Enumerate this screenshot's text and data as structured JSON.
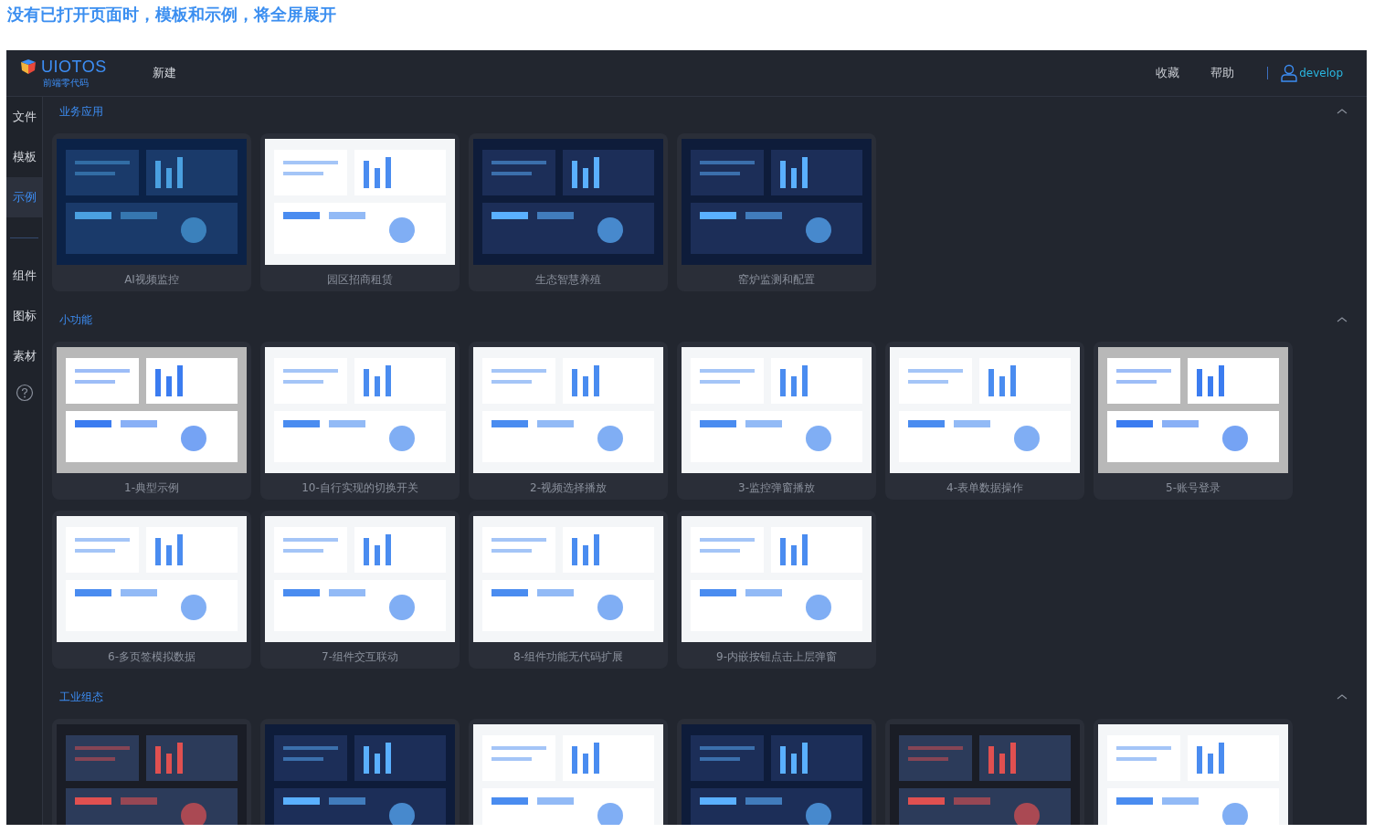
{
  "heading": "没有已打开页面时，模板和示例，将全屏展开",
  "logo": {
    "name": "UIOTOS",
    "tagline": "前端零代码"
  },
  "top_menu": [
    {
      "label": "新建"
    }
  ],
  "top_links": [
    {
      "label": "收藏"
    },
    {
      "label": "帮助"
    }
  ],
  "user": {
    "name": "develop"
  },
  "sidebar": {
    "items": [
      {
        "label": "文件",
        "selected": false
      },
      {
        "label": "模板",
        "selected": false
      },
      {
        "label": "示例",
        "selected": true
      },
      {
        "label": "组件",
        "selected": false
      },
      {
        "label": "图标",
        "selected": false
      },
      {
        "label": "素材",
        "selected": false
      }
    ]
  },
  "sections": [
    {
      "title": "业务应用",
      "expanded": true,
      "cards": [
        {
          "label": "AI视频监控"
        },
        {
          "label": "园区招商租赁"
        },
        {
          "label": "生态智慧养殖"
        },
        {
          "label": "窑炉监测和配置"
        }
      ]
    },
    {
      "title": "小功能",
      "expanded": true,
      "cards": [
        {
          "label": "1-典型示例"
        },
        {
          "label": "10-自行实现的切换开关"
        },
        {
          "label": "2-视频选择播放"
        },
        {
          "label": "3-监控弹窗播放"
        },
        {
          "label": "4-表单数据操作"
        },
        {
          "label": "5-账号登录"
        },
        {
          "label": "6-多页签模拟数据"
        },
        {
          "label": "7-组件交互联动"
        },
        {
          "label": "8-组件功能无代码扩展"
        },
        {
          "label": "9-内嵌按钮点击上层弹窗"
        }
      ]
    },
    {
      "title": "工业组态",
      "expanded": true
    }
  ]
}
